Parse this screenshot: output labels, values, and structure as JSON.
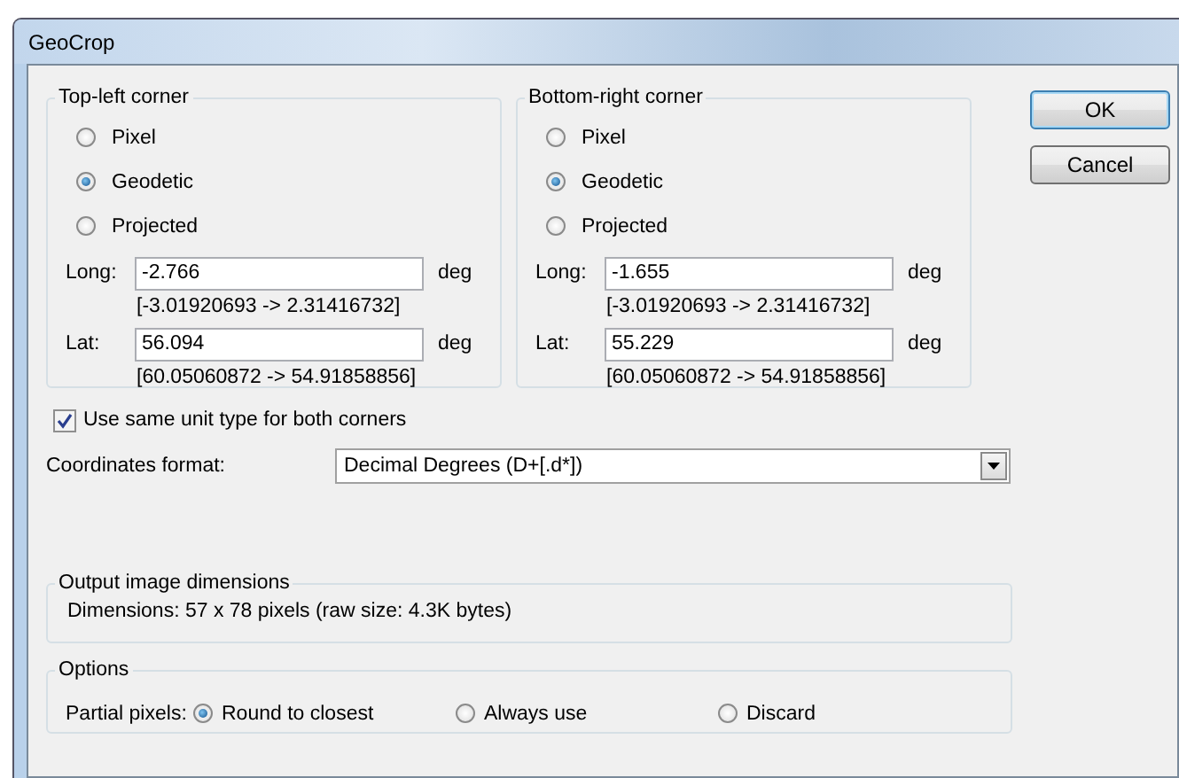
{
  "window": {
    "title": "GeoCrop"
  },
  "corners": [
    {
      "legend": "Top-left corner",
      "units": [
        {
          "label": "Pixel",
          "selected": false
        },
        {
          "label": "Geodetic",
          "selected": true
        },
        {
          "label": "Projected",
          "selected": false
        }
      ],
      "fields": [
        {
          "label": "Long:",
          "value": "-2.766",
          "unit": "deg",
          "range": "[-3.01920693 -> 2.31416732]"
        },
        {
          "label": "Lat:",
          "value": "56.094",
          "unit": "deg",
          "range": "[60.05060872 -> 54.91858856]"
        }
      ]
    },
    {
      "legend": "Bottom-right corner",
      "units": [
        {
          "label": "Pixel",
          "selected": false
        },
        {
          "label": "Geodetic",
          "selected": true
        },
        {
          "label": "Projected",
          "selected": false
        }
      ],
      "fields": [
        {
          "label": "Long:",
          "value": "-1.655",
          "unit": "deg",
          "range": "[-3.01920693 -> 2.31416732]"
        },
        {
          "label": "Lat:",
          "value": "55.229",
          "unit": "deg",
          "range": "[60.05060872 -> 54.91858856]"
        }
      ]
    }
  ],
  "same_unit": {
    "label": "Use same unit type for both corners",
    "checked": true
  },
  "coordinates_format": {
    "label": "Coordinates format:",
    "value": "Decimal Degrees (D+[.d*])"
  },
  "output": {
    "legend": "Output image dimensions",
    "text": "Dimensions: 57 x 78 pixels (raw size: 4.3K bytes)"
  },
  "options": {
    "legend": "Options",
    "label": "Partial pixels:",
    "choices": [
      {
        "label": "Round to closest",
        "selected": true
      },
      {
        "label": "Always use",
        "selected": false
      },
      {
        "label": "Discard",
        "selected": false
      }
    ]
  },
  "buttons": [
    {
      "label": "OK",
      "default": true
    },
    {
      "label": "Cancel",
      "default": false
    }
  ]
}
